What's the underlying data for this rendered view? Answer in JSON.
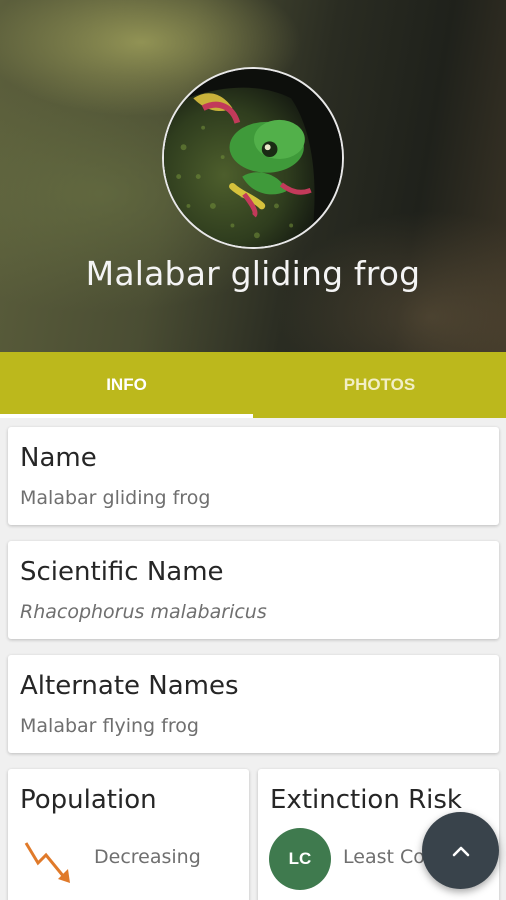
{
  "hero": {
    "title": "Malabar gliding frog",
    "photo_icon": "frog-photo"
  },
  "tabs": [
    {
      "label": "INFO",
      "active": true
    },
    {
      "label": "PHOTOS",
      "active": false
    }
  ],
  "cards": {
    "name": {
      "title": "Name",
      "value": "Malabar gliding frog"
    },
    "scientific_name": {
      "title": "Scientific Name",
      "value": "Rhacophorus malabaricus"
    },
    "alternate_names": {
      "title": "Alternate Names",
      "value": "Malabar flying frog"
    },
    "population": {
      "title": "Population",
      "value": "Decreasing",
      "icon": "trend-down-icon"
    },
    "extinction_risk": {
      "title": "Extinction Risk",
      "badge": "LC",
      "value": "Least Concern"
    }
  },
  "fab": {
    "icon": "chevron-up-icon"
  },
  "colors": {
    "tab_bar": "#bcb81c",
    "badge_lc": "#3f7a4e",
    "fab": "#39434b",
    "trend_arrow": "#e07a2a"
  }
}
